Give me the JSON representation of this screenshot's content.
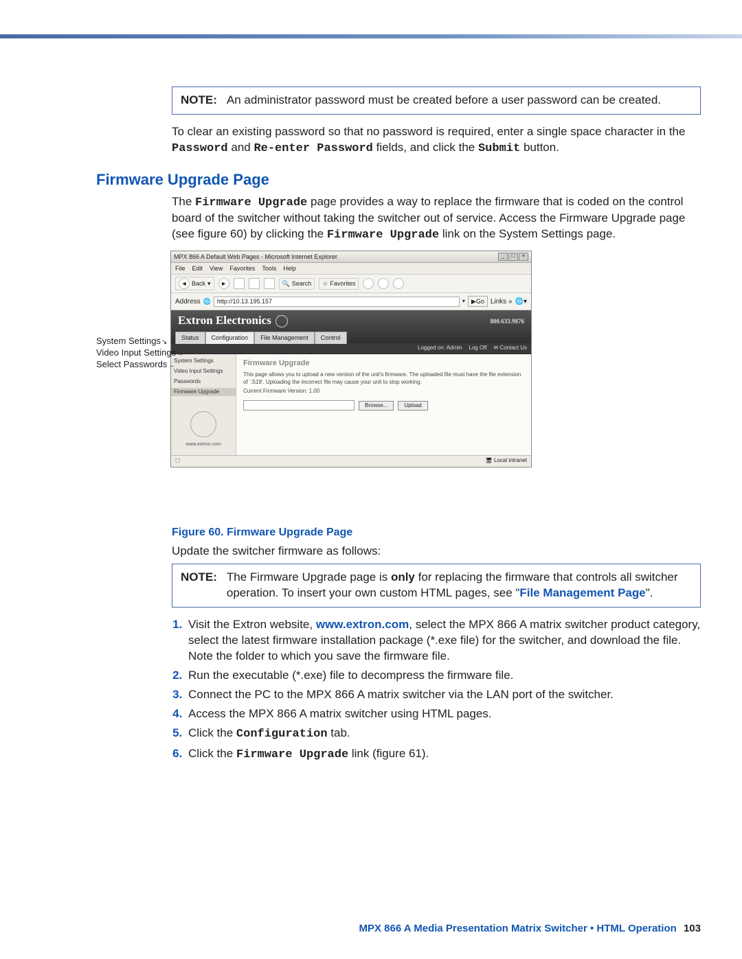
{
  "note1": {
    "label": "NOTE:",
    "text": "An administrator password must be created before a user password can be created."
  },
  "para_clear_part1": "To clear an existing password so that no password is required, enter a single space character in the ",
  "para_clear_pwd": "Password",
  "para_clear_and": " and ",
  "para_clear_re": "Re-enter Password",
  "para_clear_part2": " fields, and click the ",
  "para_clear_submit": "Submit",
  "para_clear_part3": " button.",
  "section_heading": "Firmware Upgrade Page",
  "intro_part1": "The ",
  "intro_fw": "Firmware Upgrade",
  "intro_part2": " page provides a way to replace the firmware that is coded on the control board of the switcher without taking the switcher out of service. Access the Firmware Upgrade page (see figure 60) by clicking the ",
  "intro_fw2": "Firmware Upgrade",
  "intro_part3": " link on the System Settings page.",
  "side_labels": {
    "l1": "System Settings",
    "l2": "Video Input Settings",
    "l3": "Select Passwords"
  },
  "shot": {
    "title": "MPX 866 A Default Web Pages - Microsoft Internet Explorer",
    "menus": [
      "File",
      "Edit",
      "View",
      "Favorites",
      "Tools",
      "Help"
    ],
    "back": "Back",
    "search": "Search",
    "favorites": "Favorites",
    "addr_label": "Address",
    "addr_value": "http://10.13.195.157",
    "go": "Go",
    "links": "Links »",
    "brand": "Extron Electronics",
    "tabs": [
      "Status",
      "Configuration",
      "File Management",
      "Control"
    ],
    "phone": "800.633.9876",
    "logged": "Logged on: Admin",
    "logoff": "Log Off",
    "contact": "Contact Us",
    "side_items": [
      "System Settings",
      "Video Input Settings",
      "Passwords",
      "Firmware Upgrade"
    ],
    "side_url": "www.extron.com",
    "h": "Firmware Upgrade",
    "p1": "This page allows you to upload a new version of the unit's firmware. The uploaded file must have the file extension of '.S19'. Uploading the incorrect file may cause your unit to stop working.",
    "p2": "Current Firmware Version: 1.00",
    "browse": "Browse...",
    "upload": "Upload",
    "status_right": "Local intranet"
  },
  "caption": "Figure 60. Firmware Upgrade Page",
  "update_text": "Update the switcher firmware as follows:",
  "note2": {
    "label": "NOTE:",
    "pre": "The Firmware Upgrade page is ",
    "only": "only",
    "mid": " for replacing the firmware that controls all switcher operation. To insert your own custom HTML pages, see \"",
    "link": "File Management Page",
    "post": "\"."
  },
  "steps": {
    "s1a": "Visit the Extron website, ",
    "s1link": "www.extron.com",
    "s1b": ", select the MPX 866 A matrix switcher product category, select the latest firmware installation package (*.exe file) for the switcher, and download the file. Note the folder to which you save the firmware file.",
    "s2": "Run the executable (*.exe) file to decompress the firmware file.",
    "s3": "Connect the PC to the MPX 866 A matrix switcher via the LAN port of the switcher.",
    "s4": "Access the MPX 866 A matrix switcher using HTML pages.",
    "s5a": "Click the ",
    "s5mono": "Configuration",
    "s5b": " tab.",
    "s6a": "Click the ",
    "s6mono": "Firmware Upgrade",
    "s6b": " link (figure 61)."
  },
  "footer": {
    "title": "MPX 866 A Media Presentation Matrix Switcher • HTML Operation",
    "page": "103"
  }
}
